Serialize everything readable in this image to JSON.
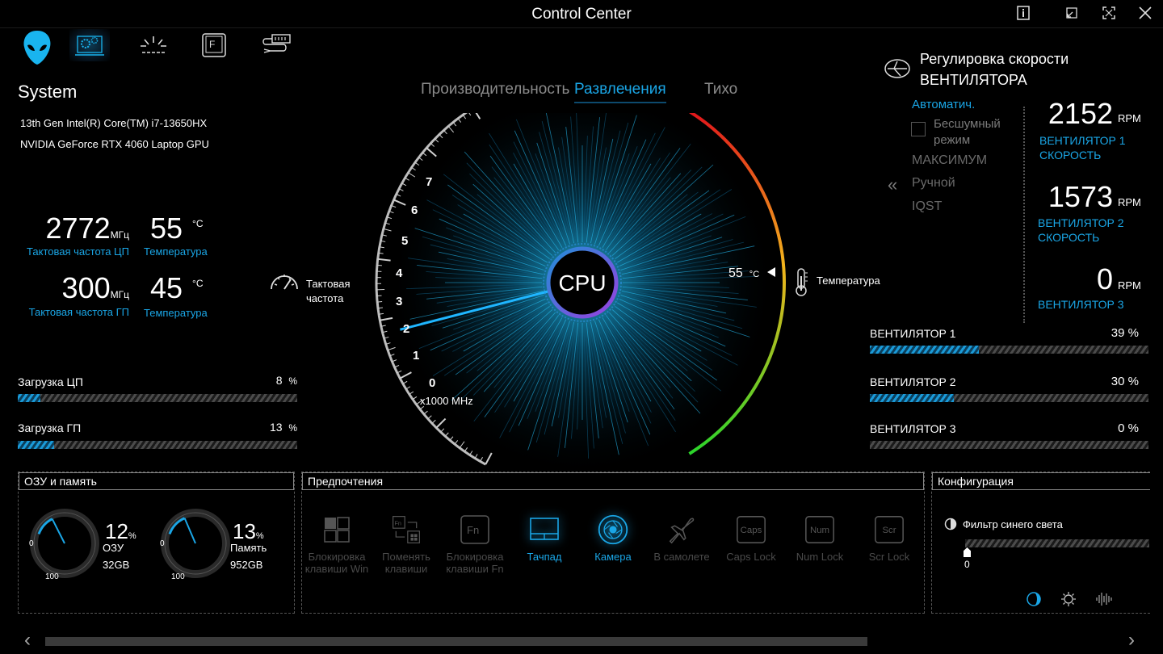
{
  "window": {
    "title": "Control Center"
  },
  "nav": {
    "icons": [
      "alien-logo-icon",
      "system-settings-icon",
      "lighting-icon",
      "function-key-icon",
      "usb-charge-icon"
    ]
  },
  "system": {
    "heading": "System",
    "cpu_model": "13th Gen Intel(R) Core(TM) i7-13650HX",
    "gpu_model": "NVIDIA GeForce RTX 4060 Laptop GPU",
    "cpu_clock": {
      "value": "2772",
      "unit": "МГц",
      "label": "Тактовая частота ЦП"
    },
    "cpu_temp": {
      "value": "55",
      "unit": "°C",
      "label": "Температура"
    },
    "gpu_clock": {
      "value": "300",
      "unit": "МГц",
      "label": "Тактовая частота ГП"
    },
    "gpu_temp": {
      "value": "45",
      "unit": "°C",
      "label": "Температура"
    },
    "cpu_load": {
      "label": "Загрузка ЦП",
      "value": "8",
      "unit": "%",
      "fraction": 0.08
    },
    "gpu_load": {
      "label": "Загрузка ГП",
      "value": "13",
      "unit": "%",
      "fraction": 0.13
    }
  },
  "modes": {
    "items": [
      "Производительность",
      "Развлечения",
      "Тихо"
    ],
    "active": "Развлечения"
  },
  "gauge": {
    "center_label": "CPU",
    "scale": [
      "0",
      "1",
      "2",
      "3",
      "4",
      "5",
      "6",
      "7"
    ],
    "scale_unit": "x1000 MHz",
    "clock_label": "Тактовая частота",
    "temp_value": "55",
    "temp_unit": "°C",
    "temp_label": "Температура",
    "needle_value": 2.772
  },
  "fan": {
    "title_line1": "Регулировка скорости",
    "title_line2": "ВЕНТИЛЯТОРА",
    "modes": {
      "auto": "Автоматич.",
      "silent_line1": "Бесшумный",
      "silent_line2": "режим",
      "max": "МАКСИМУМ",
      "manual": "Ручной",
      "iqst": "IQST"
    },
    "fan1": {
      "rpm": "2152",
      "unit": "RPM",
      "label1": "ВЕНТИЛЯТОР 1",
      "label2": "СКОРОСТЬ"
    },
    "fan2": {
      "rpm": "1573",
      "unit": "RPM",
      "label1": "ВЕНТИЛЯТОР 2",
      "label2": "СКОРОСТЬ"
    },
    "fan3": {
      "rpm": "0",
      "unit": "RPM",
      "label1": "ВЕНТИЛЯТОР 3"
    },
    "bars": [
      {
        "label": "ВЕНТИЛЯТОР 1",
        "value": "39 %",
        "fraction": 0.39
      },
      {
        "label": "ВЕНТИЛЯТОР 2",
        "value": "30 %",
        "fraction": 0.3
      },
      {
        "label": "ВЕНТИЛЯТОР 3",
        "value": "0 %",
        "fraction": 0.0
      }
    ]
  },
  "memory": {
    "title": "ОЗУ и память",
    "ram": {
      "value": "12",
      "unit": "%",
      "label": "ОЗУ",
      "size": "32GB",
      "min": "0",
      "max": "100",
      "fraction": 0.12
    },
    "storage": {
      "value": "13",
      "unit": "%",
      "label": "Память",
      "size": "952GB",
      "min": "0",
      "max": "100",
      "fraction": 0.13
    }
  },
  "prefs": {
    "title": "Предпочтения",
    "items": [
      {
        "line1": "Блокировка",
        "line2": "клавиши Win",
        "icon": "windows-key-icon",
        "on": false
      },
      {
        "line1": "Поменять",
        "line2": "клавиши",
        "icon": "swap-keys-icon",
        "on": false
      },
      {
        "line1": "Блокировка",
        "line2": "клавиши Fn",
        "icon": "fn-key-icon",
        "on": false
      },
      {
        "line1": "Тачпад",
        "line2": "",
        "icon": "touchpad-icon",
        "on": true
      },
      {
        "line1": "Камера",
        "line2": "",
        "icon": "camera-icon",
        "on": true
      },
      {
        "line1": "В самолете",
        "line2": "",
        "icon": "airplane-icon",
        "on": false
      },
      {
        "line1": "Caps Lock",
        "line2": "",
        "icon": "caps-lock-icon",
        "on": false,
        "key": "Caps"
      },
      {
        "line1": "Num Lock",
        "line2": "",
        "icon": "num-lock-icon",
        "on": false,
        "key": "Num"
      },
      {
        "line1": "Scr Lock",
        "line2": "",
        "icon": "scroll-lock-icon",
        "on": false,
        "key": "Scr"
      }
    ]
  },
  "config": {
    "title": "Конфигурация",
    "blue_filter": "Фильтр синего света",
    "slider_value": "0"
  },
  "colors": {
    "accent": "#1aa6e6",
    "background": "#000000"
  }
}
